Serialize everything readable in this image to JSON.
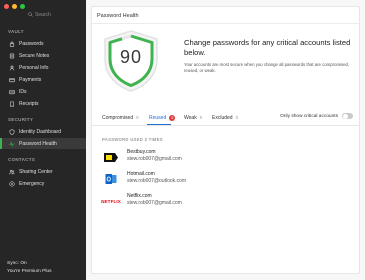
{
  "colors": {
    "sidebar_bg": "#262626",
    "accent_green": "#3fb34f",
    "accent_blue": "#1e6fd6",
    "badge_red": "#e23b3b"
  },
  "sidebar": {
    "search_placeholder": "Search",
    "sections": [
      {
        "title": "VAULT"
      },
      {
        "title": "SECURITY"
      },
      {
        "title": "CONTACTS"
      }
    ],
    "items": [
      {
        "label": "Passwords",
        "icon": "lock-icon"
      },
      {
        "label": "Secure Notes",
        "icon": "note-icon"
      },
      {
        "label": "Personal Info",
        "icon": "person-icon"
      },
      {
        "label": "Payments",
        "icon": "card-icon"
      },
      {
        "label": "IDs",
        "icon": "id-card-icon"
      },
      {
        "label": "Receipts",
        "icon": "receipt-icon"
      },
      {
        "label": "Identity Dashboard",
        "icon": "shield-icon"
      },
      {
        "label": "Password Health",
        "icon": "pulse-icon",
        "active": true
      },
      {
        "label": "Sharing Center",
        "icon": "share-icon"
      },
      {
        "label": "Emergency",
        "icon": "emergency-icon"
      }
    ],
    "footer": {
      "sync": "Sync: On",
      "plan": "You're Premium Plus"
    }
  },
  "main": {
    "title": "Password Health",
    "score": "90",
    "headline": "Change passwords for any critical accounts listed below.",
    "subtext": "Your accounts are most secure when you change all passwords that are compromised, reused, or weak.",
    "tabs": [
      {
        "label": "Compromised",
        "count": "0"
      },
      {
        "label": "Reused",
        "count": "3",
        "active": true
      },
      {
        "label": "Weak",
        "count": "0"
      },
      {
        "label": "Excluded",
        "count": "0"
      }
    ],
    "critical_toggle": {
      "label": "Only show critical accounts",
      "on": false
    },
    "group_label": "PASSWORD USED 3 TIMES",
    "entries": [
      {
        "title": "Bestbuy.com",
        "username": "stew.rob007@gmail.com",
        "logo": "bestbuy-logo"
      },
      {
        "title": "Hotmail.com",
        "username": "stew.rob007@outlook.com",
        "logo": "outlook-logo"
      },
      {
        "title": "Netflix.com",
        "username": "stew.rob007@gmail.com",
        "logo": "netflix-logo",
        "logo_text": "NETFLIX"
      }
    ]
  }
}
